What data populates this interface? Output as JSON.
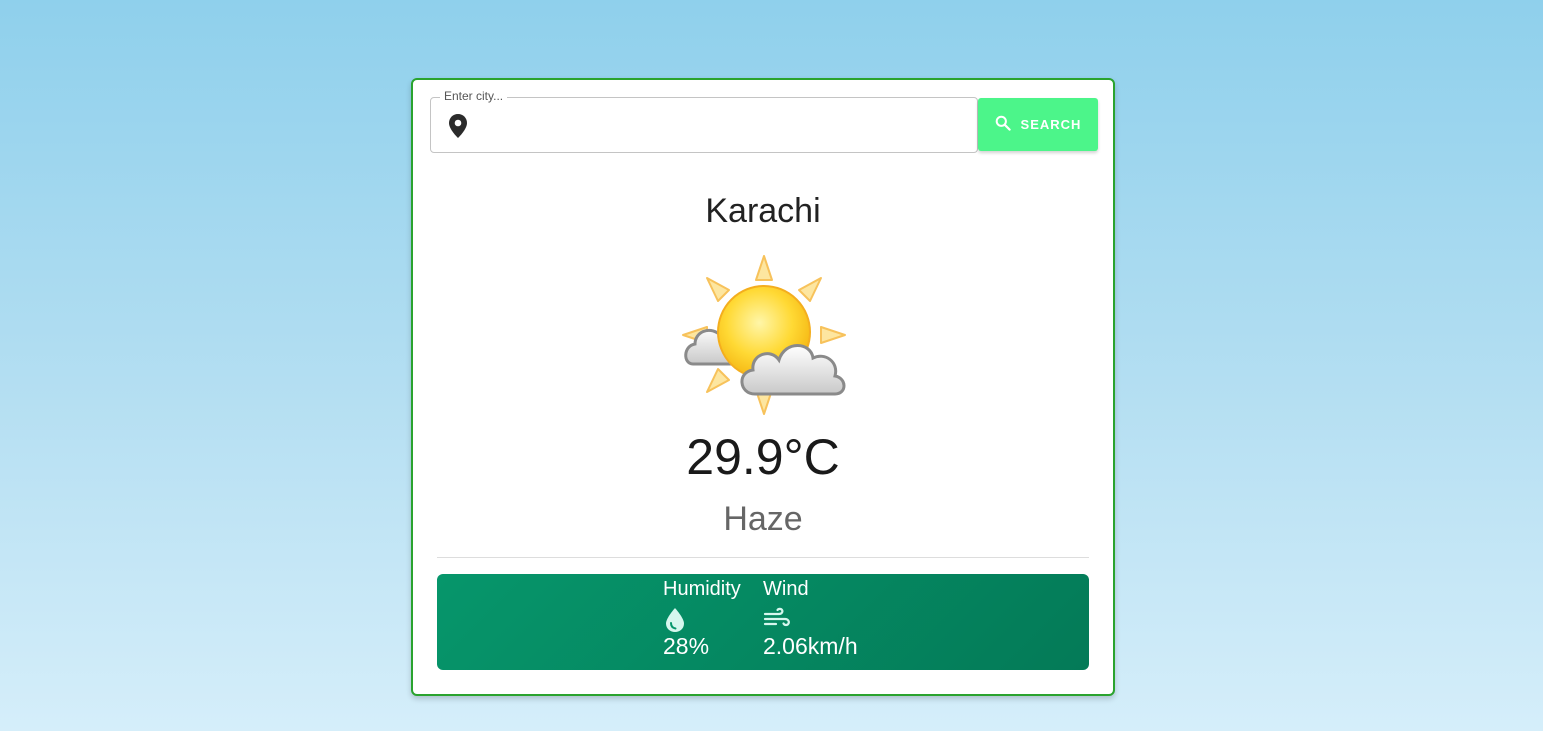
{
  "search": {
    "label": "Enter city...",
    "value": "",
    "button_label": "SEARCH",
    "button_icon": "search-icon",
    "field_icon": "location-pin-icon"
  },
  "weather": {
    "city": "Karachi",
    "icon": "partly-cloudy-sun-icon",
    "temperature": "29.9°C",
    "condition": "Haze"
  },
  "stats": {
    "humidity": {
      "label": "Humidity",
      "icon": "water-drop-icon",
      "value": "28%"
    },
    "wind": {
      "label": "Wind",
      "icon": "wind-icon",
      "value": "2.06km/h"
    }
  },
  "colors": {
    "card_border": "#2aa32e",
    "search_button": "#4cf58a",
    "stats_panel": "#06966b"
  }
}
